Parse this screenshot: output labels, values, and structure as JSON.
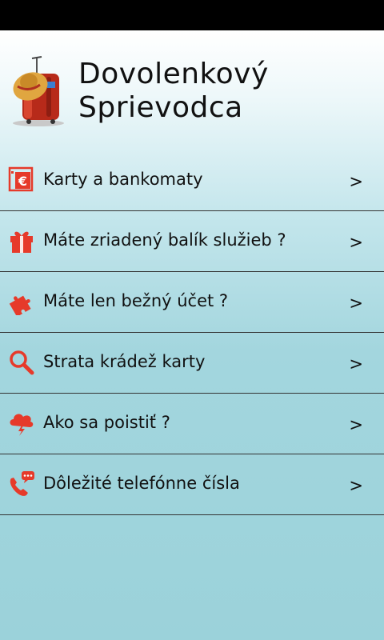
{
  "app": {
    "title": "Dovolenkový\nSprievodca",
    "accent_color": "#e63a2a",
    "logo": "suitcase-with-straw-hat-icon"
  },
  "menu": {
    "items": [
      {
        "label": "Karty a bankomaty",
        "arrow": ">",
        "icon": "atm-euro-icon"
      },
      {
        "label": "Máte zriadený balík služieb ?",
        "arrow": ">",
        "icon": "gift-icon"
      },
      {
        "label": "Máte len bežný účet ?",
        "arrow": ">",
        "icon": "puzzle-icon"
      },
      {
        "label": "Strata krádež karty",
        "arrow": ">",
        "icon": "search-icon"
      },
      {
        "label": "Ako sa poistiť ?",
        "arrow": ">",
        "icon": "storm-cloud-icon"
      },
      {
        "label": "Dôležité telefónne čísla",
        "arrow": ">",
        "icon": "phone-chat-icon"
      }
    ]
  }
}
